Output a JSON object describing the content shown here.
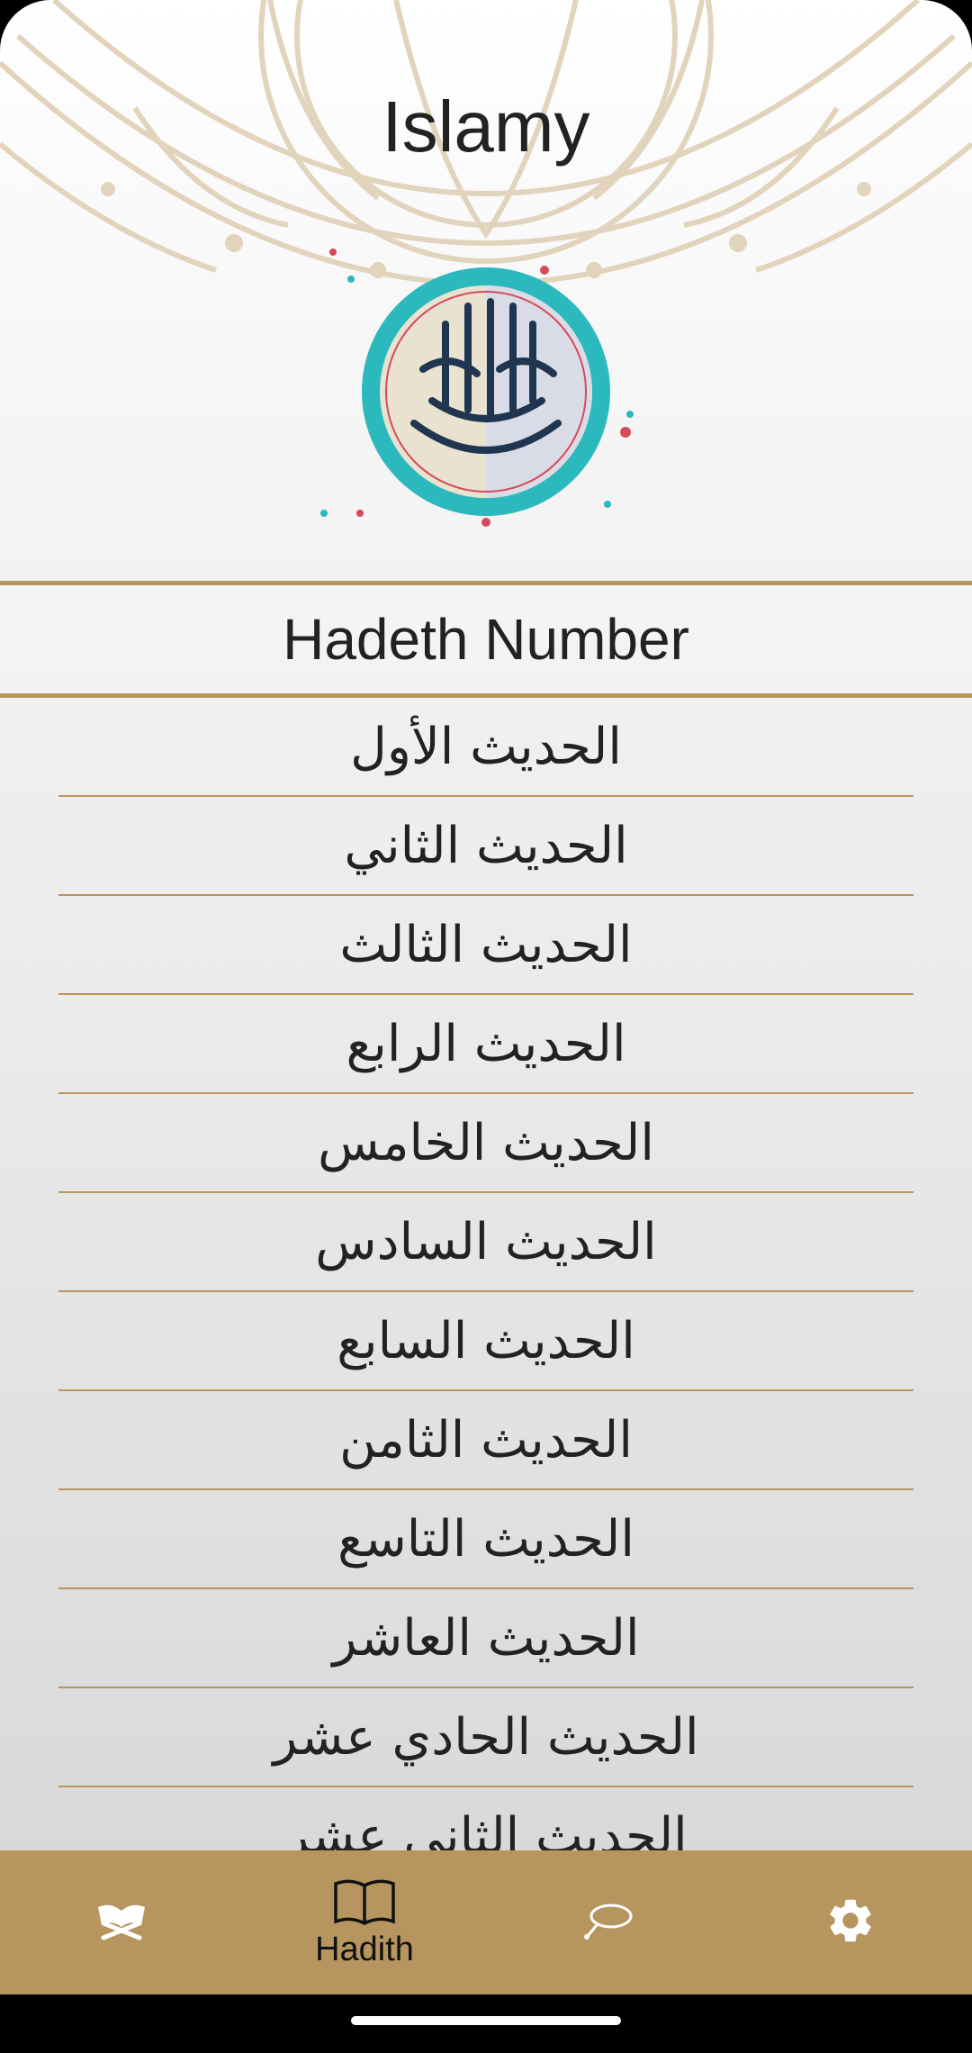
{
  "app": {
    "title": "Islamy"
  },
  "list": {
    "header": "Hadeth Number",
    "items": [
      "الحديث الأول",
      "الحديث الثاني",
      "الحديث الثالث",
      "الحديث الرابع",
      "الحديث الخامس",
      "الحديث السادس",
      "الحديث السابع",
      "الحديث الثامن",
      "الحديث التاسع",
      "الحديث العاشر",
      "الحديث الحادي عشر",
      "الحديث الثاني عشر"
    ]
  },
  "bottom_nav": {
    "items": [
      {
        "icon": "quran-icon",
        "label": ""
      },
      {
        "icon": "book-icon",
        "label": "Hadith",
        "selected": true
      },
      {
        "icon": "sebha-icon",
        "label": ""
      },
      {
        "icon": "gear-icon",
        "label": ""
      }
    ]
  },
  "colors": {
    "accent": "#b7955f",
    "text": "#222222",
    "ornament": "#e2d4bc"
  }
}
